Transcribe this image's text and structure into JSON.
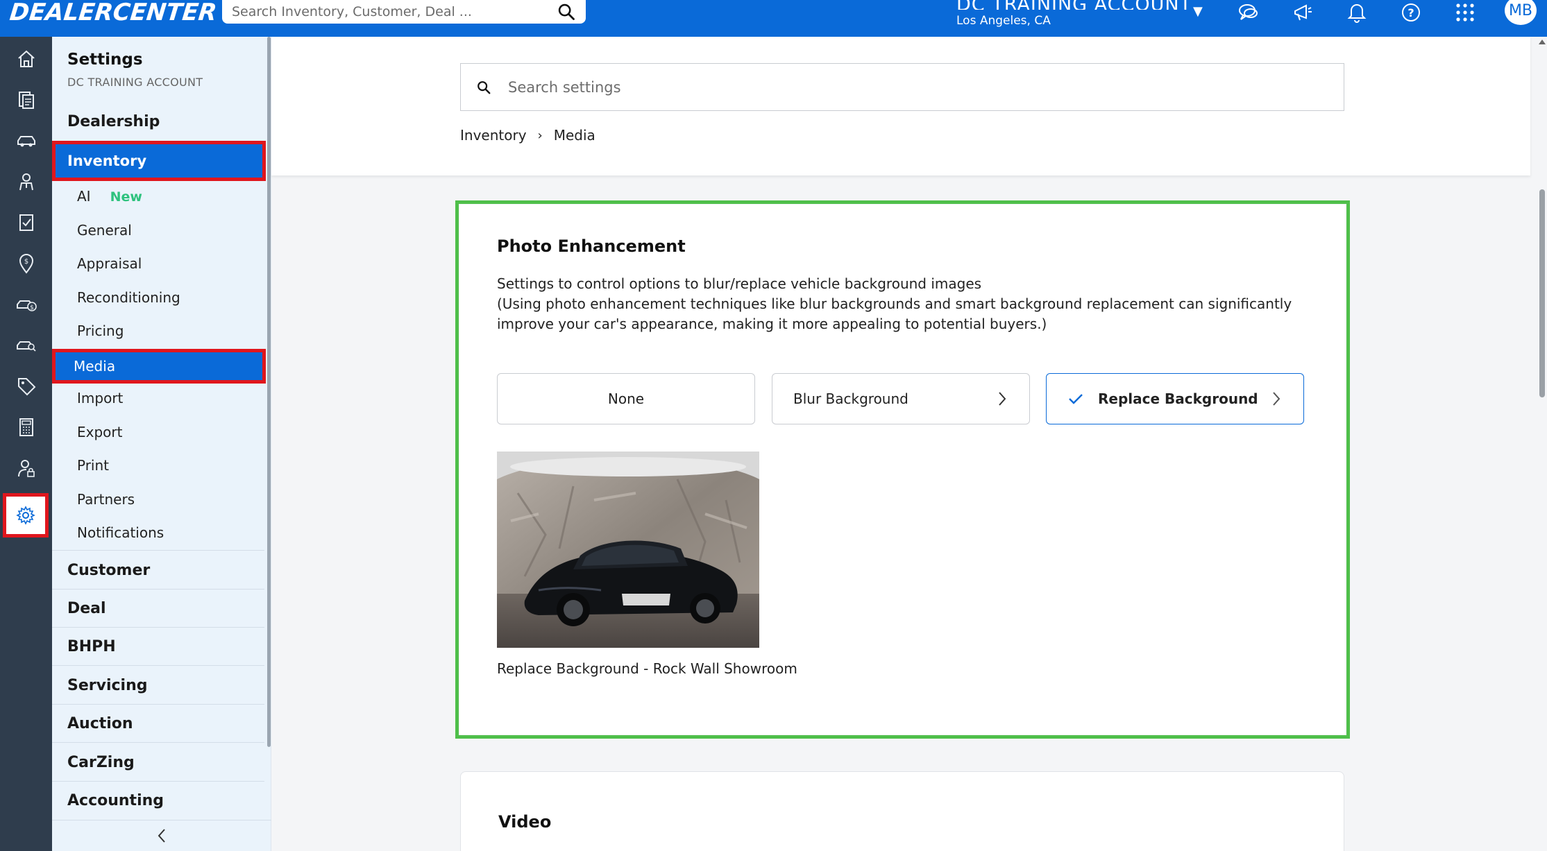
{
  "topbar": {
    "brand": "DEALERCENTER",
    "search_placeholder": "Search Inventory, Customer, Deal ...",
    "account_name": "DC TRAINING ACCOUNT",
    "account_location": "Los Angeles, CA",
    "avatar_initials": "MB",
    "icons": [
      "chat-icon",
      "megaphone-icon",
      "bell-icon",
      "help-icon",
      "apps-grid-icon"
    ]
  },
  "rail": {
    "items": [
      "home-icon",
      "documents-icon",
      "car-icon",
      "person-icon",
      "checklist-icon",
      "location-money-icon",
      "car-money-icon",
      "car-search-icon",
      "tag-icon",
      "calculator-icon",
      "user-lock-icon",
      "gear-icon"
    ],
    "active": "gear-icon"
  },
  "sidenav": {
    "title": "Settings",
    "subtitle": "DC TRAINING ACCOUNT",
    "dealership": "Dealership",
    "inventory": "Inventory",
    "inventory_items": [
      {
        "label": "AI",
        "badge": "New"
      },
      {
        "label": "General"
      },
      {
        "label": "Appraisal"
      },
      {
        "label": "Reconditioning"
      },
      {
        "label": "Pricing"
      },
      {
        "label": "Media"
      },
      {
        "label": "Import"
      },
      {
        "label": "Export"
      },
      {
        "label": "Print"
      },
      {
        "label": "Partners"
      },
      {
        "label": "Notifications"
      }
    ],
    "sections": [
      "Customer",
      "Deal",
      "BHPH",
      "Servicing",
      "Auction",
      "CarZing",
      "Accounting"
    ]
  },
  "main": {
    "search_placeholder": "Search settings",
    "breadcrumb": [
      "Inventory",
      "Media"
    ],
    "photo_enhancement": {
      "title": "Photo Enhancement",
      "desc_line1": "Settings to control options to blur/replace vehicle background images",
      "desc_line2": "(Using photo enhancement techniques like blur backgrounds and smart background replacement can significantly improve your car's appearance, making it more appealing to potential buyers.)",
      "options": {
        "none": "None",
        "blur": "Blur Background",
        "replace": "Replace Background"
      },
      "selected": "replace",
      "preview_caption": "Replace Background - Rock Wall Showroom"
    },
    "video_title": "Video"
  }
}
